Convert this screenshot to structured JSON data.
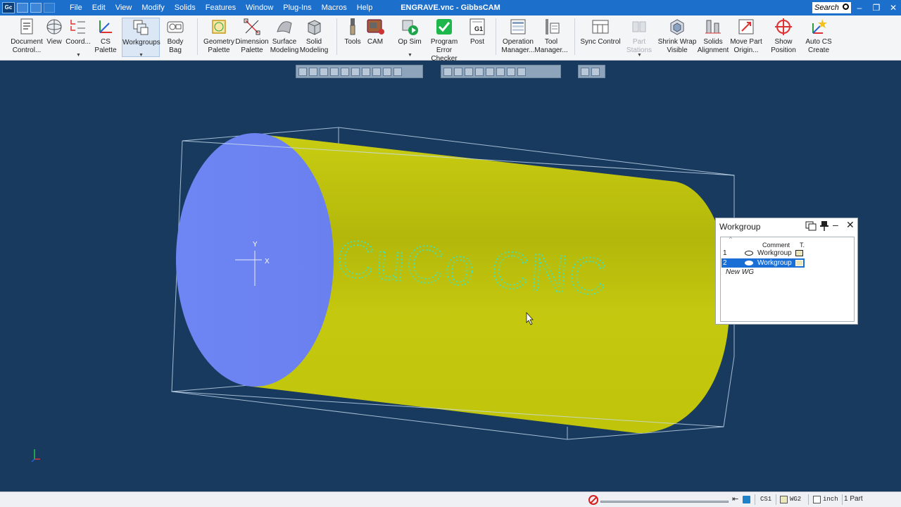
{
  "app": {
    "logo": "Gc",
    "title": "ENGRAVE.vnc - GibbsCAM",
    "menu": [
      "File",
      "Edit",
      "View",
      "Modify",
      "Solids",
      "Features",
      "Window",
      "Plug-Ins",
      "Macros",
      "Help"
    ],
    "search_label": "Search",
    "window_controls": [
      "–",
      "❐",
      "✕"
    ]
  },
  "ribbon": {
    "document_control": [
      "Document",
      "Control..."
    ],
    "view": "View",
    "coord": "Coord...",
    "cs_palette": "CS Palette",
    "workgroups": "Workgroups",
    "body_bag": "Body Bag",
    "geometry_palette": [
      "Geometry",
      "Palette"
    ],
    "dimension_palette": [
      "Dimension",
      "Palette"
    ],
    "surface_modeling": [
      "Surface",
      "Modeling"
    ],
    "solid_modeling": [
      "Solid",
      "Modeling"
    ],
    "tools": "Tools",
    "cam": "CAM",
    "op_sim": "Op Sim",
    "program_error_checker": [
      "Program Error",
      "Checker"
    ],
    "post": "Post",
    "post_badge": "G1",
    "operation_manager": [
      "Operation",
      "Manager..."
    ],
    "tool_manager": [
      "Tool",
      "Manager..."
    ],
    "sync_control": "Sync Control",
    "part_stations": "Part Stations",
    "shrink_wrap_visible": [
      "Shrink Wrap",
      "Visible"
    ],
    "solids_alignment": [
      "Solids",
      "Alignment"
    ],
    "move_part_origin": [
      "Move Part",
      "Origin..."
    ],
    "show_position": "Show Position",
    "auto_cs_create": [
      "Auto CS",
      "Create"
    ]
  },
  "viewport": {
    "engrave_text": "CuCo CNC",
    "axis_y": "Y",
    "axis_x": "X",
    "colors": {
      "background": "#173a5e",
      "cylinder": "#c8cc0c",
      "end_face": "#6b82f2",
      "text_outline": "#35e6cf",
      "text_points": "#f2ef38",
      "bounding_box": "#c9dcef"
    }
  },
  "workgroup_panel": {
    "title": "Workgroup",
    "columns": {
      "comment": "Comment",
      "type": "T."
    },
    "rows": [
      {
        "num": "1",
        "comment": "Workgroup",
        "selected": false
      },
      {
        "num": "2",
        "comment": "Workgroup",
        "selected": true
      }
    ],
    "new_label": "New WG"
  },
  "status": {
    "progress": 0.0,
    "cs": "CS1",
    "wg": "WG2",
    "unit": "inch",
    "parts": "1 Part"
  }
}
